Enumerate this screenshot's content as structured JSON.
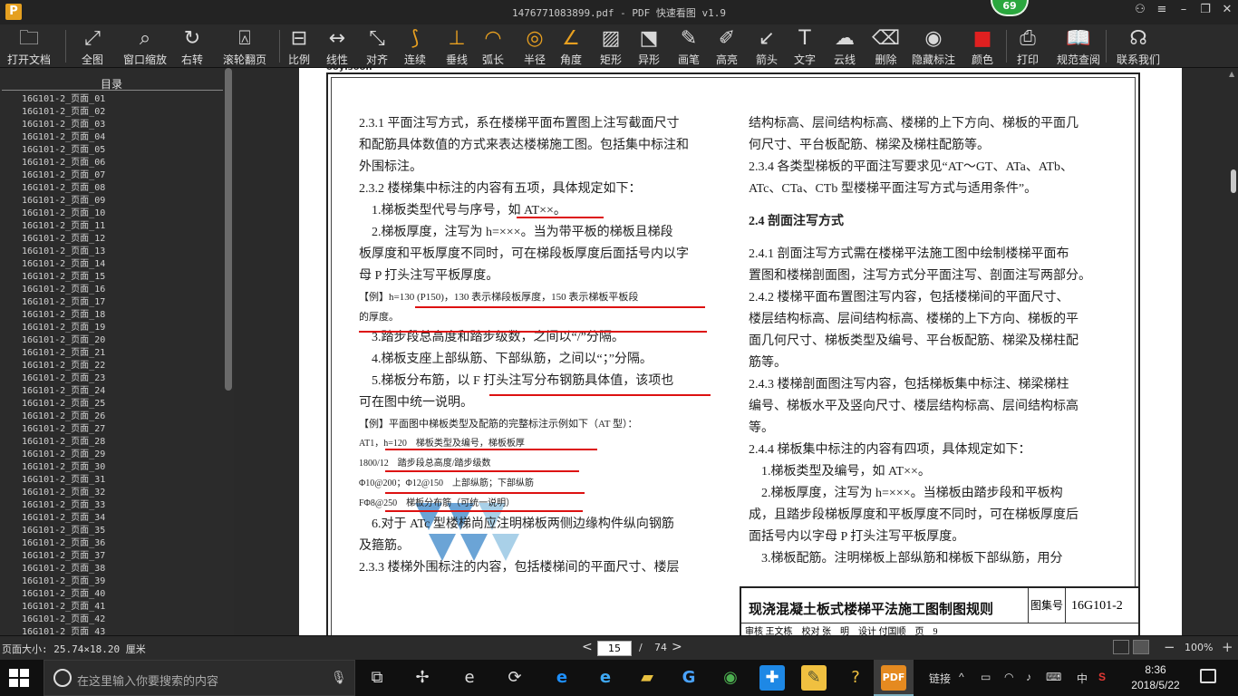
{
  "window": {
    "title": "1476771083899.pdf - PDF 快速看图 v1.9",
    "badge": "69",
    "app_icon": "P"
  },
  "toolbar": [
    {
      "label": "打开文档",
      "icon": "folder-icon",
      "glyph": "🗀",
      "tone": "white"
    },
    {
      "label": "全图",
      "icon": "fit-all-icon",
      "glyph": "⤢",
      "tone": "white"
    },
    {
      "label": "窗口缩放",
      "icon": "magnifier-icon",
      "glyph": "⌕",
      "tone": "white"
    },
    {
      "label": "右转",
      "icon": "rotate-right-icon",
      "glyph": "↻",
      "tone": "white"
    },
    {
      "label": "滚轮翻页",
      "icon": "mouse-icon",
      "glyph": "⍓",
      "tone": "white"
    },
    {
      "label": "比例",
      "icon": "scale-icon",
      "glyph": "⊟",
      "tone": "white"
    },
    {
      "label": "线性",
      "icon": "linear-measure-icon",
      "glyph": "↔",
      "tone": "white"
    },
    {
      "label": "对齐",
      "icon": "align-measure-icon",
      "glyph": "⤡",
      "tone": "white"
    },
    {
      "label": "连续",
      "icon": "continuous-measure-icon",
      "glyph": "⟆",
      "tone": "orange"
    },
    {
      "label": "垂线",
      "icon": "perpendicular-icon",
      "glyph": "⊥",
      "tone": "orange"
    },
    {
      "label": "弧长",
      "icon": "arc-length-icon",
      "glyph": "◠",
      "tone": "orange"
    },
    {
      "label": "半径",
      "icon": "radius-icon",
      "glyph": "◎",
      "tone": "orange"
    },
    {
      "label": "角度",
      "icon": "angle-icon",
      "glyph": "∠",
      "tone": "orange"
    },
    {
      "label": "矩形",
      "icon": "rectangle-area-icon",
      "glyph": "▨",
      "tone": "white"
    },
    {
      "label": "异形",
      "icon": "polygon-area-icon",
      "glyph": "⬔",
      "tone": "white"
    },
    {
      "label": "画笔",
      "icon": "pencil-icon",
      "glyph": "✎",
      "tone": "white"
    },
    {
      "label": "高亮",
      "icon": "highlighter-icon",
      "glyph": "✐",
      "tone": "white"
    },
    {
      "label": "箭头",
      "icon": "arrow-icon",
      "glyph": "↙",
      "tone": "white"
    },
    {
      "label": "文字",
      "icon": "text-icon",
      "glyph": "T",
      "tone": "white"
    },
    {
      "label": "云线",
      "icon": "cloud-line-icon",
      "glyph": "☁",
      "tone": "white"
    },
    {
      "label": "删除",
      "icon": "eraser-icon",
      "glyph": "⌫",
      "tone": "white"
    },
    {
      "label": "隐藏标注",
      "icon": "hide-annotation-icon",
      "glyph": "◉",
      "tone": "white"
    },
    {
      "label": "颜色",
      "icon": "color-icon",
      "glyph": "■",
      "tone": "red"
    },
    {
      "label": "打印",
      "icon": "printer-icon",
      "glyph": "⎙",
      "tone": "white"
    },
    {
      "label": "规范查阅",
      "icon": "book-search-icon",
      "glyph": "📖",
      "tone": "white"
    },
    {
      "label": "联系我们",
      "icon": "support-icon",
      "glyph": "☊",
      "tone": "white"
    }
  ],
  "sidebar": {
    "heading": "目录",
    "items": [
      "16G101-2_页面_01",
      "16G101-2_页面_02",
      "16G101-2_页面_03",
      "16G101-2_页面_04",
      "16G101-2_页面_05",
      "16G101-2_页面_06",
      "16G101-2_页面_07",
      "16G101-2_页面_08",
      "16G101-2_页面_09",
      "16G101-2_页面_10",
      "16G101-2_页面_11",
      "16G101-2_页面_12",
      "16G101-2_页面_13",
      "16G101-2_页面_14",
      "16G101-2_页面_15",
      "16G101-2_页面_16",
      "16G101-2_页面_17",
      "16G101-2_页面_18",
      "16G101-2_页面_19",
      "16G101-2_页面_20",
      "16G101-2_页面_21",
      "16G101-2_页面_22",
      "16G101-2_页面_23",
      "16G101-2_页面_24",
      "16G101-2_页面_25",
      "16G101-2_页面_26",
      "16G101-2_页面_27",
      "16G101-2_页面_28",
      "16G101-2_页面_29",
      "16G101-2_页面_30",
      "16G101-2_页面_31",
      "16G101-2_页面_32",
      "16G101-2_页面_33",
      "16G101-2_页面_34",
      "16G101-2_页面_35",
      "16G101-2_页面_36",
      "16G101-2_页面_37",
      "16G101-2_页面_38",
      "16G101-2_页面_39",
      "16G101-2_页面_40",
      "16G101-2_页面_41",
      "16G101-2_页面_42",
      "16G101-2_页面_43"
    ]
  },
  "doc": {
    "left": [
      "2.3.1 平面注写方式，系在楼梯平面布置图上注写截面尺寸",
      "和配筋具体数值的方式来表达楼梯施工图。包括集中标注和",
      "外围标注。",
      "2.3.2 楼梯集中标注的内容有五项，具体规定如下：",
      "　1.梯板类型代号与序号，如 AT××。",
      "　2.梯板厚度，注写为 h=×××。当为带平板的梯板且梯段",
      "板厚度和平板厚度不同时，可在梯段板厚度后面括号内以字",
      "母 P 打头注写平板厚度。",
      "【例】h=130 (P150)，130 表示梯段板厚度，150 表示梯板平板段",
      "的厚度。",
      "　3.踏步段总高度和踏步级数，之间以“/”分隔。",
      "　4.梯板支座上部纵筋、下部纵筋，之间以“；”分隔。",
      "　5.梯板分布筋，以 F 打头注写分布钢筋具体值，该项也",
      "可在图中统一说明。",
      "【例】平面图中梯板类型及配筋的完整标注示例如下（AT 型）：",
      "AT1，h=120　梯板类型及编号，梯板板厚",
      "1800/12　踏步段总高度/踏步级数",
      "Φ10@200；Φ12@150　上部纵筋；下部纵筋",
      "FΦ8@250　梯板分布筋（可统一说明）",
      "　6.对于 ATc 型楼梯尚应注明梯板两侧边缘构件纵向钢筋",
      "及箍筋。",
      "2.3.3 楼梯外围标注的内容，包括楼梯间的平面尺寸、楼层"
    ],
    "right": [
      "结构标高、层间结构标高、楼梯的上下方向、梯板的平面几",
      "何尺寸、平台板配筋、梯梁及梯柱配筋等。",
      "2.3.4 各类型梯板的平面注写要求见“AT～GT、ATa、ATb、",
      "ATc、CTa、CTb 型楼梯平面注写方式与适用条件”。",
      "",
      "2.4 剖面注写方式",
      "",
      "2.4.1 剖面注写方式需在楼梯平法施工图中绘制楼梯平面布",
      "置图和楼梯剖面图，注写方式分平面注写、剖面注写两部分。",
      "2.4.2 楼梯平面布置图注写内容，包括楼梯间的平面尺寸、",
      "楼层结构标高、层间结构标高、楼梯的上下方向、梯板的平",
      "面几何尺寸、梯板类型及编号、平台板配筋、梯梁及梯柱配",
      "筋等。",
      "2.4.3 楼梯剖面图注写内容，包括梯板集中标注、梯梁梯柱",
      "编号、梯板水平及竖向尺寸、楼层结构标高、层间结构标高",
      "等。",
      "2.4.4 梯板集中标注的内容有四项，具体规定如下：",
      "　1.梯板类型及编号，如 AT××。",
      "　2.梯板厚度，注写为 h=×××。当梯板由踏步段和平板构",
      "成，且踏步段梯板厚度和平板厚度不同时，可在梯板厚度后",
      "面括号内以字母 P 打头注写平板厚度。",
      "　3.梯板配筋。注明梯板上部纵筋和梯板下部纵筋，用分"
    ],
    "title_block": {
      "title": "现浇混凝土板式楼梯平法施工图制图规则",
      "label": "图集号",
      "code": "16G101-2",
      "row2": "审核 王文栋　校对 张　明　设计 付国顺　页　9"
    },
    "page_header_fragment": "ooyisoon"
  },
  "status": {
    "page_size": "页面大小: 25.74×18.20 厘米",
    "current_page": "15",
    "total_pages": "74",
    "zoom": "100%",
    "prev": "<",
    "next": ">"
  },
  "taskbar": {
    "search_placeholder": "在这里输入你要搜索的内容",
    "tray_link": "链接",
    "ime": "中",
    "time": "8:36",
    "date": "2018/5/22"
  }
}
